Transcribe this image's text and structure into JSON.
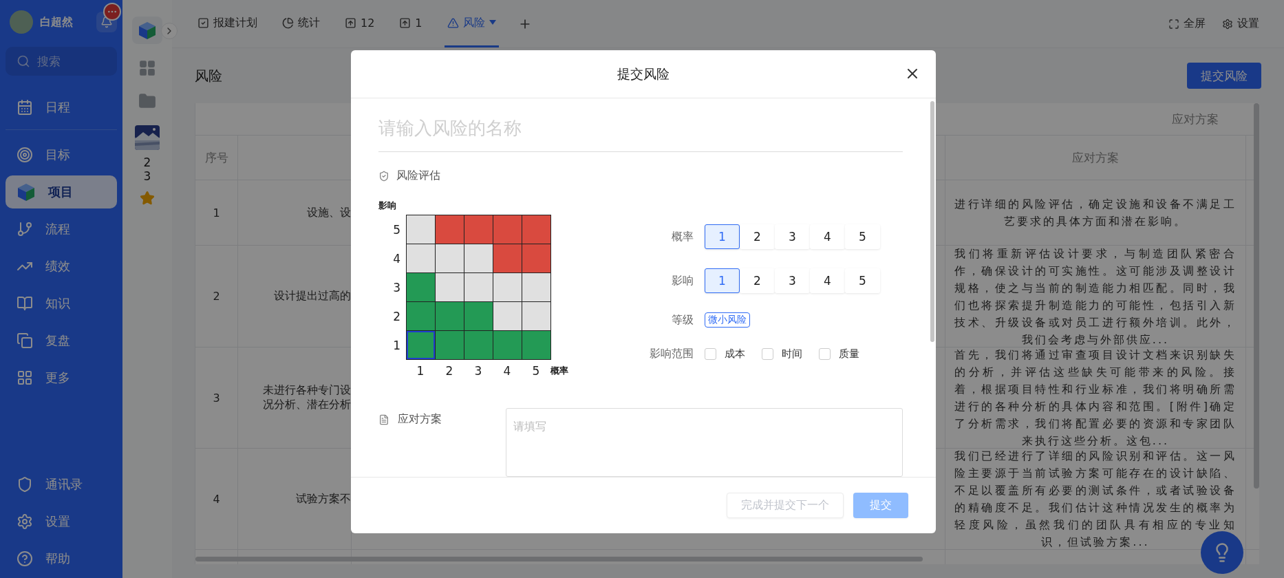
{
  "sidebar": {
    "user": {
      "name": "白超然"
    },
    "search": {
      "placeholder": "搜索"
    },
    "nav_top": [
      {
        "label": "日程",
        "selected": false
      }
    ],
    "nav_main": [
      {
        "label": "目标",
        "selected": false
      },
      {
        "label": "项目",
        "selected": true
      },
      {
        "label": "流程",
        "selected": false
      },
      {
        "label": "绩效",
        "selected": false
      },
      {
        "label": "知识",
        "selected": false
      },
      {
        "label": "复盘",
        "selected": false
      },
      {
        "label": "更多",
        "selected": false
      }
    ],
    "nav_bottom": [
      {
        "label": "通讯录",
        "selected": false
      },
      {
        "label": "设置",
        "selected": false
      },
      {
        "label": "帮助",
        "selected": false
      }
    ]
  },
  "rail": {
    "count": "23",
    "starred": true
  },
  "tabs": [
    {
      "label": "报建计划",
      "selected": false
    },
    {
      "label": "统计",
      "selected": false
    },
    {
      "label": "12",
      "selected": false
    },
    {
      "label": "1",
      "selected": false
    },
    {
      "label": "风险",
      "selected": true
    }
  ],
  "actions": [
    {
      "label": "全屏"
    },
    {
      "label": "设置"
    }
  ],
  "page": {
    "title": "风险",
    "submit_button": "提交风险"
  },
  "table": {
    "group_header": "应对方案",
    "columns": {
      "index": "序号",
      "response": "应对方案"
    },
    "rows": [
      {
        "index": "1",
        "column_2": "设施、设",
        "response": "进行详细的风险评估，确定设施和设备不满足工艺要求的具体方面和潜在影响。"
      },
      {
        "index": "2",
        "column_2": "设计提出过高的",
        "response": "我们将重新评估设计要求，与制造团队紧密合作，确保设计的可实施性。这可能涉及调整设计规格，使之与当前的制造能力相匹配。同时，我们也将探索提升制造能力的可能性，包括引入新技术、升级设备或对员工进行额外培训。此外，我们会考虑与外部供应..."
      },
      {
        "index": "3",
        "column_2": "未进行各种专门设况分析、潜在分析",
        "response": "首先，我们将通过审查项目设计文档来识别缺失的分析，并评估这些缺失可能带来的风险。接着，根据项目特性和行业标准，我们将明确所需进行的各种分析的具体内容和范围。[附件]确定了分析需求，我们将配置必要的资源和专家团队来执行这些分析。这包..."
      },
      {
        "index": "4",
        "column_2": "试验方案不",
        "response": "我们已经进行了详细的风险识别和评估。这一风险主要源于当前试验方案可能存在的设计缺陷、不足以覆盖所有必要的测试条件，或者试验设备的精确度不足。我们估计这种情况发生的概率为轻度风险，虽然我们的团队具有相应的专业知识，但试验方案..."
      }
    ]
  },
  "modal": {
    "title": "提交风险",
    "name_field": {
      "placeholder": "请输入风险的名称"
    },
    "assessment": {
      "title": "风险评估",
      "matrix": {
        "y_label": "影响",
        "x_label": "概率",
        "y_ticks": [
          "5",
          "4",
          "3",
          "2",
          "1"
        ],
        "x_ticks": [
          "1",
          "2",
          "3",
          "4",
          "5"
        ],
        "rows": [
          {
            "cells": [
              {
                "color": "#e0e0e0",
                "selected": false
              },
              {
                "color": "#d94a3f",
                "selected": false
              },
              {
                "color": "#d94a3f",
                "selected": false
              },
              {
                "color": "#d94a3f",
                "selected": false
              },
              {
                "color": "#d94a3f",
                "selected": false
              }
            ]
          },
          {
            "cells": [
              {
                "color": "#e0e0e0",
                "selected": false
              },
              {
                "color": "#e0e0e0",
                "selected": false
              },
              {
                "color": "#e0e0e0",
                "selected": false
              },
              {
                "color": "#d94a3f",
                "selected": false
              },
              {
                "color": "#d94a3f",
                "selected": false
              }
            ]
          },
          {
            "cells": [
              {
                "color": "#239a55",
                "selected": false
              },
              {
                "color": "#e0e0e0",
                "selected": false
              },
              {
                "color": "#e0e0e0",
                "selected": false
              },
              {
                "color": "#e0e0e0",
                "selected": false
              },
              {
                "color": "#e0e0e0",
                "selected": false
              }
            ]
          },
          {
            "cells": [
              {
                "color": "#239a55",
                "selected": false
              },
              {
                "color": "#239a55",
                "selected": false
              },
              {
                "color": "#239a55",
                "selected": false
              },
              {
                "color": "#e0e0e0",
                "selected": false
              },
              {
                "color": "#e0e0e0",
                "selected": false
              }
            ]
          },
          {
            "cells": [
              {
                "color": "#239a55",
                "selected": true
              },
              {
                "color": "#239a55",
                "selected": false
              },
              {
                "color": "#239a55",
                "selected": false
              },
              {
                "color": "#239a55",
                "selected": false
              },
              {
                "color": "#239a55",
                "selected": false
              }
            ]
          }
        ]
      },
      "probability": {
        "label": "概率",
        "options": [
          {
            "label": "1",
            "selected": true
          },
          {
            "label": "2",
            "selected": false
          },
          {
            "label": "3",
            "selected": false
          },
          {
            "label": "4",
            "selected": false
          },
          {
            "label": "5",
            "selected": false
          }
        ]
      },
      "impact": {
        "label": "影响",
        "options": [
          {
            "label": "1",
            "selected": true
          },
          {
            "label": "2",
            "selected": false
          },
          {
            "label": "3",
            "selected": false
          },
          {
            "label": "4",
            "selected": false
          },
          {
            "label": "5",
            "selected": false
          }
        ]
      },
      "grade": {
        "label": "等级",
        "value": "微小风险"
      },
      "scope": {
        "label": "影响范围",
        "options": [
          {
            "label": "成本",
            "checked": false
          },
          {
            "label": "时间",
            "checked": false
          },
          {
            "label": "质量",
            "checked": false
          }
        ]
      }
    },
    "response": {
      "label": "应对方案",
      "placeholder": "请填写"
    },
    "buttons": [
      {
        "label": "完成并提交下一个",
        "kind": "secondary",
        "disabled": true
      },
      {
        "label": "提交",
        "kind": "primary",
        "disabled": true
      }
    ]
  }
}
